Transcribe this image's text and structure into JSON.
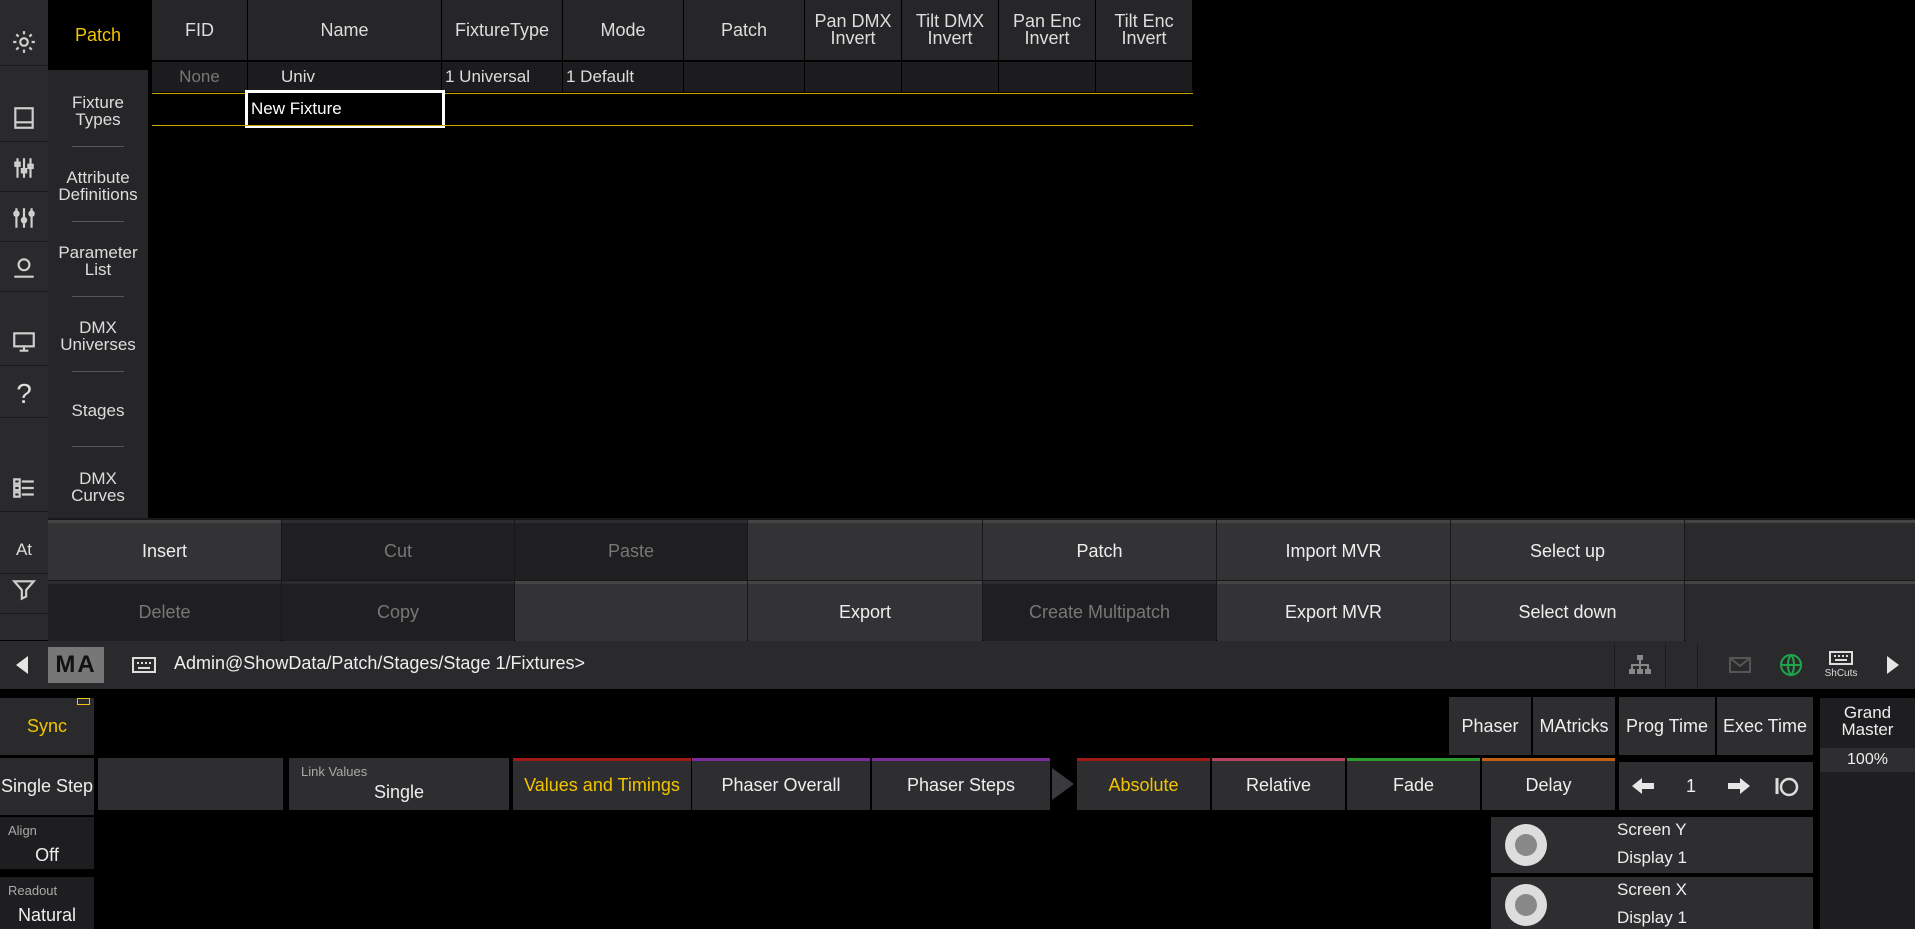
{
  "sidebar": {
    "patch_label": "Patch",
    "at_label": "At",
    "menu": [
      "Fixture Types",
      "Attribute Definitions",
      "Parameter List",
      "DMX Universes",
      "Stages",
      "DMX Curves"
    ]
  },
  "table": {
    "headers": [
      "FID",
      "Name",
      "FixtureType",
      "Mode",
      "Patch",
      "Pan DMX Invert",
      "Tilt DMX Invert",
      "Pan Enc Invert",
      "Tilt Enc Invert"
    ],
    "row": {
      "fid": "None",
      "name": "Univ",
      "fixturetype": "1 Universal",
      "mode": "1 Default"
    },
    "new_name": "New Fixture"
  },
  "commands": {
    "insert": "Insert",
    "cut": "Cut",
    "paste": "Paste",
    "patch": "Patch",
    "import_mvr": "Import MVR",
    "select_up": "Select up",
    "delete": "Delete",
    "copy": "Copy",
    "export": "Export",
    "create_multipatch": "Create Multipatch",
    "export_mvr": "Export MVR",
    "select_down": "Select down"
  },
  "cmdline": {
    "logo": "MA",
    "path": "Admin@ShowData/Patch/Stages/Stage 1/Fixtures>",
    "shcuts": "ShCuts"
  },
  "bottom": {
    "sync": "Sync",
    "single_step": "Single Step",
    "link_values_label": "Link Values",
    "link_values": "Single",
    "values_timings": "Values and Timings",
    "phaser_overall": "Phaser Overall",
    "phaser_steps": "Phaser Steps",
    "absolute": "Absolute",
    "relative": "Relative",
    "fade": "Fade",
    "delay": "Delay",
    "align_label": "Align",
    "align": "Off",
    "readout_label": "Readout",
    "readout": "Natural",
    "phaser": "Phaser",
    "matricks": "MAtricks",
    "prog_time": "Prog Time",
    "exec_time": "Exec Time",
    "step": "1",
    "grand_master": "Grand Master",
    "grand_value": "100%",
    "enc1_title": "Screen Y",
    "enc1_sub": "Display 1",
    "enc2_title": "Screen X",
    "enc2_sub": "Display 1"
  },
  "colors": {
    "accent": "#f2c500",
    "green": "#1fa64a"
  }
}
